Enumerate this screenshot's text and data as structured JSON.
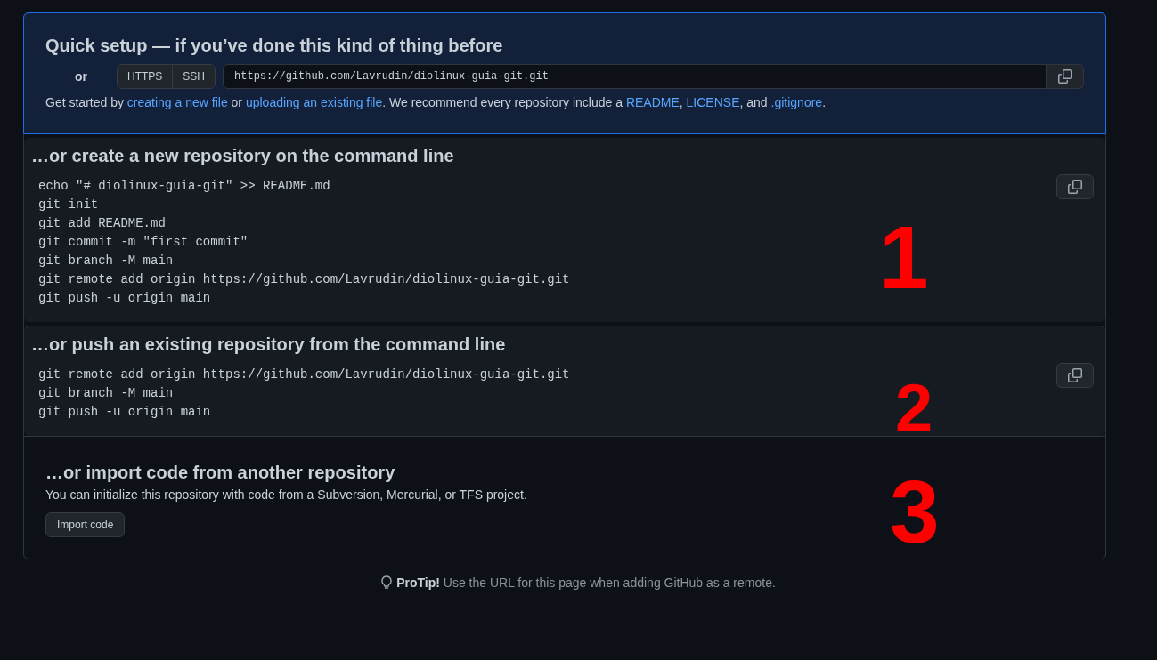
{
  "quick_setup": {
    "title": "Quick setup — if you’ve done this kind of thing before",
    "or_label": "or",
    "protocols": [
      "HTTPS",
      "SSH"
    ],
    "url": "https://github.com/Lavrudin/diolinux-guia-git.git",
    "intro": [
      {
        "kind": "text",
        "text": "Get started by "
      },
      {
        "kind": "link",
        "text": "creating a new file"
      },
      {
        "kind": "text",
        "text": " or "
      },
      {
        "kind": "link",
        "text": "uploading an existing file"
      },
      {
        "kind": "text",
        "text": ". We recommend every repository include a "
      },
      {
        "kind": "link",
        "text": "README"
      },
      {
        "kind": "text",
        "text": ", "
      },
      {
        "kind": "link",
        "text": "LICENSE"
      },
      {
        "kind": "text",
        "text": ", and "
      },
      {
        "kind": "link",
        "text": ".gitignore"
      },
      {
        "kind": "text",
        "text": "."
      }
    ]
  },
  "sections": [
    {
      "kind": "code",
      "title": "…or create a new repository on the command line",
      "annotation": "1",
      "lines": [
        "echo \"# diolinux-guia-git\" >> README.md",
        "git init",
        "git add README.md",
        "git commit -m \"first commit\"",
        "git branch -M main",
        "git remote add origin https://github.com/Lavrudin/diolinux-guia-git.git",
        "git push -u origin main"
      ]
    },
    {
      "kind": "code",
      "title": "…or push an existing repository from the command line",
      "annotation": "2",
      "lines": [
        "git remote add origin https://github.com/Lavrudin/diolinux-guia-git.git",
        "git branch -M main",
        "git push -u origin main"
      ]
    },
    {
      "kind": "import",
      "title": "…or import code from another repository",
      "annotation": "3",
      "description": "You can initialize this repository with code from a Subversion, Mercurial, or TFS project.",
      "button": "Import code"
    }
  ],
  "protip": {
    "label": "ProTip!",
    "text": "Use the URL for this page when adding GitHub as a remote."
  }
}
